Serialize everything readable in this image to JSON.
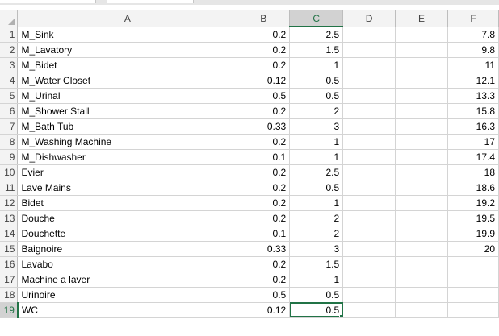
{
  "columns": [
    "A",
    "B",
    "C",
    "D",
    "E",
    "F"
  ],
  "selected_column": "C",
  "selected_row": 19,
  "accent_color": "#217346",
  "rows": [
    {
      "n": "1",
      "a": "M_Sink",
      "b": "0.2",
      "c": "2.5",
      "d": "",
      "e": "",
      "f": "7.8"
    },
    {
      "n": "2",
      "a": "M_Lavatory",
      "b": "0.2",
      "c": "1.5",
      "d": "",
      "e": "",
      "f": "9.8"
    },
    {
      "n": "3",
      "a": "M_Bidet",
      "b": "0.2",
      "c": "1",
      "d": "",
      "e": "",
      "f": "11"
    },
    {
      "n": "4",
      "a": "M_Water Closet",
      "b": "0.12",
      "c": "0.5",
      "d": "",
      "e": "",
      "f": "12.1"
    },
    {
      "n": "5",
      "a": "M_Urinal",
      "b": "0.5",
      "c": "0.5",
      "d": "",
      "e": "",
      "f": "13.3"
    },
    {
      "n": "6",
      "a": "M_Shower Stall",
      "b": "0.2",
      "c": "2",
      "d": "",
      "e": "",
      "f": "15.8"
    },
    {
      "n": "7",
      "a": "M_Bath Tub",
      "b": "0.33",
      "c": "3",
      "d": "",
      "e": "",
      "f": "16.3"
    },
    {
      "n": "8",
      "a": "M_Washing Machine",
      "b": "0.2",
      "c": "1",
      "d": "",
      "e": "",
      "f": "17"
    },
    {
      "n": "9",
      "a": "M_Dishwasher",
      "b": "0.1",
      "c": "1",
      "d": "",
      "e": "",
      "f": "17.4"
    },
    {
      "n": "10",
      "a": "Evier",
      "b": "0.2",
      "c": "2.5",
      "d": "",
      "e": "",
      "f": "18"
    },
    {
      "n": "11",
      "a": "Lave Mains",
      "b": "0.2",
      "c": "0.5",
      "d": "",
      "e": "",
      "f": "18.6"
    },
    {
      "n": "12",
      "a": "Bidet",
      "b": "0.2",
      "c": "1",
      "d": "",
      "e": "",
      "f": "19.2"
    },
    {
      "n": "13",
      "a": "Douche",
      "b": "0.2",
      "c": "2",
      "d": "",
      "e": "",
      "f": "19.5"
    },
    {
      "n": "14",
      "a": "Douchette",
      "b": "0.1",
      "c": "2",
      "d": "",
      "e": "",
      "f": "19.9"
    },
    {
      "n": "15",
      "a": "Baignoire",
      "b": "0.33",
      "c": "3",
      "d": "",
      "e": "",
      "f": "20"
    },
    {
      "n": "16",
      "a": "Lavabo",
      "b": "0.2",
      "c": "1.5",
      "d": "",
      "e": "",
      "f": ""
    },
    {
      "n": "17",
      "a": "Machine a laver",
      "b": "0.2",
      "c": "1",
      "d": "",
      "e": "",
      "f": ""
    },
    {
      "n": "18",
      "a": "Urinoire",
      "b": "0.5",
      "c": "0.5",
      "d": "",
      "e": "",
      "f": ""
    },
    {
      "n": "19",
      "a": "WC",
      "b": "0.12",
      "c": "0.5",
      "d": "",
      "e": "",
      "f": ""
    }
  ]
}
